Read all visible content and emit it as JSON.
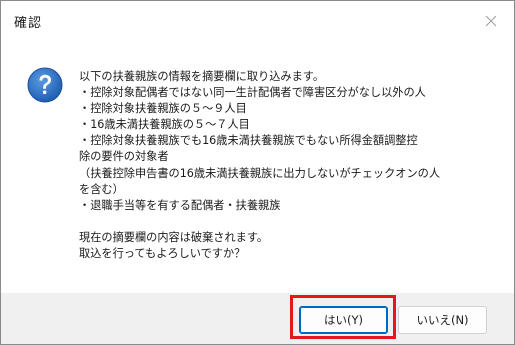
{
  "window": {
    "title": "確認",
    "close_icon": "close-icon"
  },
  "dialog": {
    "icon": "question-icon",
    "icon_color": "#1f5fb4",
    "message_lines": [
      "以下の扶養親族の情報を摘要欄に取り込みます。",
      "・控除対象配偶者ではない同一生計配偶者で障害区分がなし以外の人",
      "・控除対象扶養親族の５～９人目",
      "・16歳未満扶養親族の５～７人目",
      "・控除対象扶養親族でも16歳未満扶養親族でもない所得金額調整控",
      "除の要件の対象者",
      "（扶養控除申告書の16歳未満扶養親族に出力しないがチェックオンの人",
      "を含む）",
      "・退職手当等を有する配偶者・扶養親族",
      "",
      "現在の摘要欄の内容は破棄されます。",
      "取込を行ってもよろしいですか？"
    ]
  },
  "buttons": {
    "yes_label": "はい(Y)",
    "no_label": "いいえ(N)"
  },
  "colors": {
    "highlight": "#e8161c",
    "default_button_border": "#0067c0",
    "footer_bg": "#f0f0f0"
  }
}
